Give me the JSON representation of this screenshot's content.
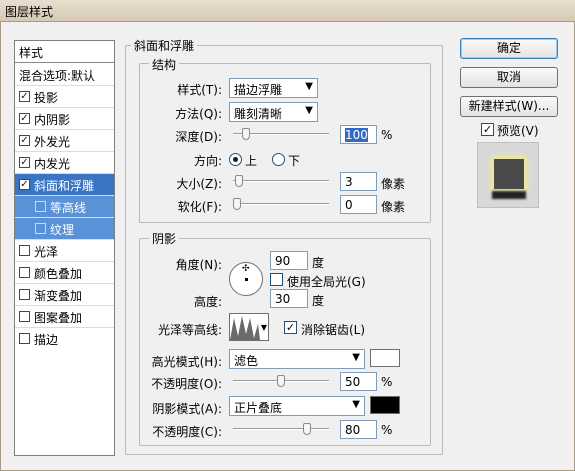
{
  "window": {
    "title": "图层样式"
  },
  "sidebar": {
    "header": "样式",
    "items": [
      {
        "label": "混合选项:默认",
        "checked": null
      },
      {
        "label": "投影",
        "checked": true
      },
      {
        "label": "内阴影",
        "checked": true
      },
      {
        "label": "外发光",
        "checked": true
      },
      {
        "label": "内发光",
        "checked": true
      },
      {
        "label": "斜面和浮雕",
        "checked": true
      },
      {
        "label": "等高线",
        "checked": false
      },
      {
        "label": "纹理",
        "checked": false
      },
      {
        "label": "光泽",
        "checked": false
      },
      {
        "label": "颜色叠加",
        "checked": false
      },
      {
        "label": "渐变叠加",
        "checked": false
      },
      {
        "label": "图案叠加",
        "checked": false
      },
      {
        "label": "描边",
        "checked": false
      }
    ]
  },
  "bevel": {
    "section_title": "斜面和浮雕",
    "structure_title": "结构",
    "style_label": "样式(T):",
    "style_value": "描边浮雕",
    "technique_label": "方法(Q):",
    "technique_value": "雕刻清晰",
    "depth_label": "深度(D):",
    "depth_value": "100",
    "depth_unit": "%",
    "depth_slider_fraction": 0.1,
    "direction_label": "方向:",
    "direction_up": "上",
    "direction_down": "下",
    "direction_selected": "上",
    "size_label": "大小(Z):",
    "size_value": "3",
    "size_unit": "像素",
    "size_slider_fraction": 0.02,
    "soften_label": "软化(F):",
    "soften_value": "0",
    "soften_unit": "像素",
    "soften_slider_fraction": 0.0
  },
  "shading": {
    "title": "阴影",
    "angle_label": "角度(N):",
    "angle_value": "90",
    "angle_unit": "度",
    "global_light_label": "使用全局光(G)",
    "global_light_checked": false,
    "altitude_label": "高度:",
    "altitude_value": "30",
    "altitude_unit": "度",
    "gloss_contour_label": "光泽等高线:",
    "antialias_label": "消除锯齿(L)",
    "antialias_checked": true,
    "highlight_mode_label": "高光模式(H):",
    "highlight_mode_value": "滤色",
    "highlight_color": "#ffffff",
    "highlight_opacity_label": "不透明度(O):",
    "highlight_opacity_value": "50",
    "highlight_opacity_unit": "%",
    "highlight_opacity_fraction": 0.5,
    "shadow_mode_label": "阴影模式(A):",
    "shadow_mode_value": "正片叠底",
    "shadow_color": "#000000",
    "shadow_opacity_label": "不透明度(C):",
    "shadow_opacity_value": "80",
    "shadow_opacity_unit": "%",
    "shadow_opacity_fraction": 0.8
  },
  "buttons": {
    "ok": "确定",
    "cancel": "取消",
    "new_style": "新建样式(W)...",
    "preview_label": "预览(V)",
    "preview_checked": true
  }
}
